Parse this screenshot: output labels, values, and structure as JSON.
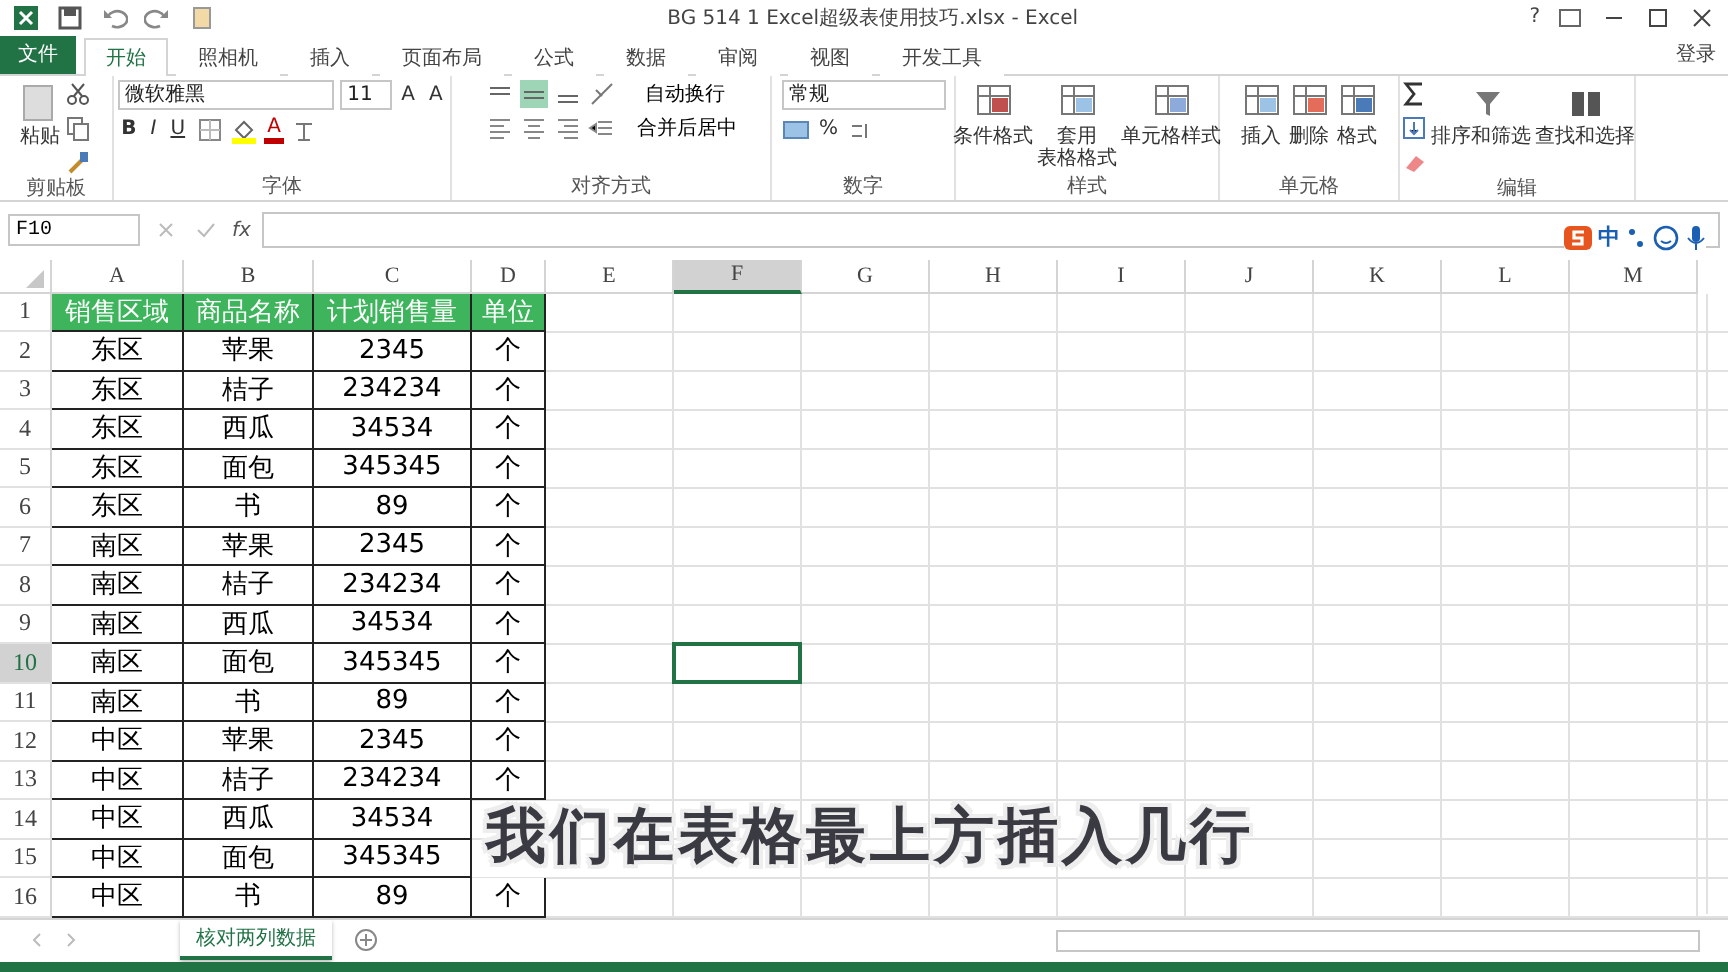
{
  "window": {
    "title": "BG 514 1 Excel超级表使用技巧.xlsx - Excel",
    "help": "?"
  },
  "file_tab": "文件",
  "tabs": [
    {
      "label": "开始",
      "selected": true
    },
    {
      "label": "照相机",
      "selected": false
    },
    {
      "label": "插入",
      "selected": false
    },
    {
      "label": "页面布局",
      "selected": false
    },
    {
      "label": "公式",
      "selected": false
    },
    {
      "label": "数据",
      "selected": false
    },
    {
      "label": "审阅",
      "selected": false
    },
    {
      "label": "视图",
      "selected": false
    },
    {
      "label": "开发工具",
      "selected": false
    }
  ],
  "sign_in": "登录",
  "ribbon": {
    "clipboard": {
      "label": "剪贴板",
      "paste": "粘贴"
    },
    "font": {
      "label": "字体",
      "font_name": "微软雅黑",
      "font_size": "11",
      "grow": "A",
      "shrink": "A",
      "bold": "B",
      "italic": "I",
      "underline": "U",
      "font_color": "A"
    },
    "alignment": {
      "label": "对齐方式",
      "wrap_text": "自动换行",
      "merge_center": "合并后居中",
      "vertical_align": [
        {
          "selected": false
        },
        {
          "selected": true
        },
        {
          "selected": false
        }
      ]
    },
    "number": {
      "label": "数字",
      "format": "常规",
      "percent": "%"
    },
    "styles": {
      "label": "样式",
      "buttons": [
        {
          "lines": [
            "条件格式"
          ]
        },
        {
          "lines": [
            "套用",
            "表格格式"
          ]
        },
        {
          "lines": [
            "单元格样式"
          ]
        }
      ]
    },
    "cells": {
      "label": "单元格",
      "buttons": [
        "插入",
        "删除",
        "格式"
      ]
    },
    "editing": {
      "label": "编辑",
      "buttons": [
        "排序和筛选",
        "查找和选择"
      ]
    }
  },
  "formula_bar": {
    "name_box": "F10",
    "function_label": "fx"
  },
  "ime_bar": {
    "mode": "中"
  },
  "columns": [
    {
      "label": "A",
      "selected": false
    },
    {
      "label": "B",
      "selected": false
    },
    {
      "label": "C",
      "selected": false
    },
    {
      "label": "D",
      "selected": false
    },
    {
      "label": "E",
      "selected": false
    },
    {
      "label": "F",
      "selected": true
    },
    {
      "label": "G",
      "selected": false
    },
    {
      "label": "H",
      "selected": false
    },
    {
      "label": "I",
      "selected": false
    },
    {
      "label": "J",
      "selected": false
    },
    {
      "label": "K",
      "selected": false
    },
    {
      "label": "L",
      "selected": false
    },
    {
      "label": "M",
      "selected": false
    }
  ],
  "rows": [
    {
      "number": "1",
      "selected": false,
      "header": true,
      "cells": [
        "销售区域",
        "商品名称",
        "计划销售量",
        "单位"
      ]
    },
    {
      "number": "2",
      "selected": false,
      "cells": [
        "东区",
        "苹果",
        "2345",
        "个"
      ]
    },
    {
      "number": "3",
      "selected": false,
      "cells": [
        "东区",
        "桔子",
        "234234",
        "个"
      ]
    },
    {
      "number": "4",
      "selected": false,
      "cells": [
        "东区",
        "西瓜",
        "34534",
        "个"
      ]
    },
    {
      "number": "5",
      "selected": false,
      "cells": [
        "东区",
        "面包",
        "345345",
        "个"
      ]
    },
    {
      "number": "6",
      "selected": false,
      "cells": [
        "东区",
        "书",
        "89",
        "个"
      ]
    },
    {
      "number": "7",
      "selected": false,
      "cells": [
        "南区",
        "苹果",
        "2345",
        "个"
      ]
    },
    {
      "number": "8",
      "selected": false,
      "cells": [
        "南区",
        "桔子",
        "234234",
        "个"
      ]
    },
    {
      "number": "9",
      "selected": false,
      "cells": [
        "南区",
        "西瓜",
        "34534",
        "个"
      ]
    },
    {
      "number": "10",
      "selected": true,
      "cells": [
        "南区",
        "面包",
        "345345",
        "个"
      ]
    },
    {
      "number": "11",
      "selected": false,
      "cells": [
        "南区",
        "书",
        "89",
        "个"
      ]
    },
    {
      "number": "12",
      "selected": false,
      "cells": [
        "中区",
        "苹果",
        "2345",
        "个"
      ]
    },
    {
      "number": "13",
      "selected": false,
      "cells": [
        "中区",
        "桔子",
        "234234",
        "个"
      ]
    },
    {
      "number": "14",
      "selected": false,
      "cells": [
        "中区",
        "西瓜",
        "34534",
        null
      ]
    },
    {
      "number": "15",
      "selected": false,
      "cells": [
        "中区",
        "面包",
        "345345",
        null
      ]
    },
    {
      "number": "16",
      "selected": false,
      "cells": [
        "中区",
        "书",
        "89",
        "个"
      ]
    }
  ],
  "sheet_tabs": [
    {
      "label": "核对两列数据",
      "selected": true
    }
  ],
  "caption": "我们在表格最上方插入几行"
}
